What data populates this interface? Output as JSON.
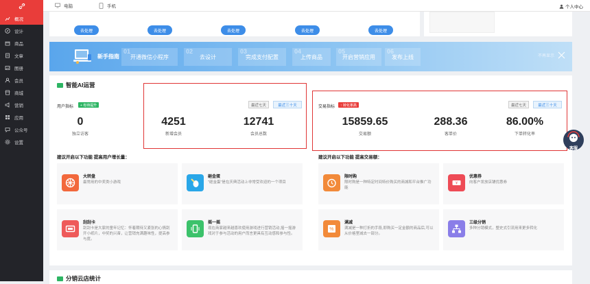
{
  "sidebar": {
    "items": [
      {
        "label": "概况",
        "icon": "chart-icon"
      },
      {
        "label": "设计",
        "icon": "compass-icon"
      },
      {
        "label": "商品",
        "icon": "box-icon"
      },
      {
        "label": "文章",
        "icon": "document-icon"
      },
      {
        "label": "图册",
        "icon": "image-icon"
      },
      {
        "label": "会员",
        "icon": "user-icon"
      },
      {
        "label": "商城",
        "icon": "store-icon"
      },
      {
        "label": "营销",
        "icon": "megaphone-icon"
      },
      {
        "label": "应用",
        "icon": "grid-icon"
      },
      {
        "label": "公众号",
        "icon": "message-icon"
      },
      {
        "label": "设置",
        "icon": "gear-icon"
      }
    ]
  },
  "topbar": {
    "pc": "电脑",
    "mobile": "手机",
    "user": "个人中心"
  },
  "todo": {
    "label": "去处理"
  },
  "guide": {
    "title": "新手指南",
    "close": "不再显示",
    "steps": [
      {
        "n": "01",
        "label": "开通微信小程序"
      },
      {
        "n": "02",
        "label": "去设计"
      },
      {
        "n": "03",
        "label": "完成支付配置"
      },
      {
        "n": "04",
        "label": "上传商品"
      },
      {
        "n": "05",
        "label": "开启营销应用"
      },
      {
        "n": "06",
        "label": "发布上线"
      }
    ]
  },
  "ai": {
    "title": "智能AI运营",
    "user_metrics": {
      "title": "用户指标",
      "badge": "+ 有待提升",
      "btn7": "最近七天",
      "btn30": "最近三十天",
      "stats": [
        {
          "value": "0",
          "label": "独立访客"
        },
        {
          "value": "4251",
          "label": "新增会员"
        },
        {
          "value": "12741",
          "label": "会员总数"
        }
      ]
    },
    "trade_metrics": {
      "title": "交易指标",
      "badge": "↑ 转化率高",
      "btn7": "最近七天",
      "btn30": "最近三十天",
      "stats": [
        {
          "value": "15859.65",
          "label": "交易额"
        },
        {
          "value": "288.36",
          "label": "客单价"
        },
        {
          "value": "86.00%",
          "label": "下单转化率"
        }
      ]
    },
    "left_suggest": "建议开启以下功能 提高用户增长量：",
    "right_suggest": "建议开启以下功能 提高交易额：",
    "left_features": [
      {
        "title": "大转盘",
        "desc": "最常用的中奖类小游戏"
      },
      {
        "title": "砸金蛋",
        "desc": "\"砸金蛋\"是在庆典活动上非常受欢迎的一个项目"
      },
      {
        "title": "刮刮卡",
        "desc": "刮刮卡是大家的童年记忆：怀着期待又紧张的心情刮开小纸片，中奖的兴奋，让营销充满趣味性，提高参与度。"
      },
      {
        "title": "摇一摇",
        "desc": "现在商家越来越喜欢使用游戏进行营销活动,摇一摇游戏对于参与活动的用户而言更具有互动感和参与性。"
      }
    ],
    "right_features": [
      {
        "title": "限时购",
        "desc": "限时购是一种特定时间特价购买的商城和平台推广功能"
      },
      {
        "title": "优惠券",
        "desc": "向客户发放店铺优惠券"
      },
      {
        "title": "满减",
        "desc": "满减是一种打折的手段,即购买一定金额的商品后,可以从价格里减去一部分。"
      },
      {
        "title": "三级分销",
        "desc": "多种分销模式，整史式引流用来更多转化"
      }
    ]
  },
  "bottom": {
    "title": "分销云店统计"
  },
  "service": {
    "label": "客服"
  },
  "colors": {
    "brand": "#e93d3a",
    "sidebar": "#232429",
    "accent": "#3d8de8",
    "green": "#2db563"
  }
}
